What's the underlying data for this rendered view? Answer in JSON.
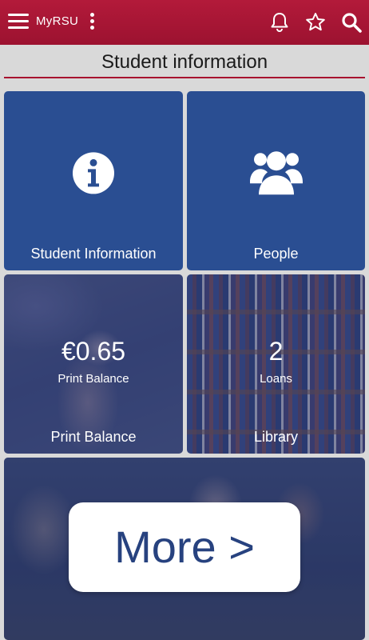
{
  "appbar": {
    "title": "MyRSU",
    "icons": [
      "menu-icon",
      "more-vert-icon",
      "bell-icon",
      "star-icon",
      "search-icon"
    ]
  },
  "section": {
    "title": "Student information"
  },
  "tiles": {
    "student_info": {
      "label": "Student Information",
      "icon": "info-icon"
    },
    "people": {
      "label": "People",
      "icon": "people-icon"
    },
    "print": {
      "value": "€0.65",
      "value_label": "Print Balance",
      "label": "Print Balance"
    },
    "library": {
      "value": "2",
      "value_label": "Loans",
      "label": "Library"
    }
  },
  "more": {
    "label": "More >"
  },
  "colors": {
    "brand": "#a8122f",
    "tile_blue": "#2a4e92",
    "more_text": "#27427f"
  }
}
